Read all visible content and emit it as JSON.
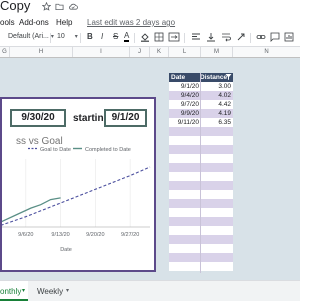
{
  "window": {
    "doc_title": "Copy"
  },
  "menu": {
    "items": [
      "ools",
      "Add-ons",
      "Help"
    ],
    "last_edit": "Last edit was 2 days ago"
  },
  "toolbar": {
    "font_name": "Default (Ari...",
    "font_size": "10",
    "bold": "B",
    "italic": "I",
    "strike": "S",
    "text_color": "A"
  },
  "columns": [
    "G",
    "H",
    "I",
    "J",
    "K",
    "L",
    "M",
    "N"
  ],
  "dashboard": {
    "end_date": "9/30/20",
    "starting_on_label": "starting on",
    "start_date": "9/1/20"
  },
  "table": {
    "headers": [
      "Date",
      "Distance"
    ],
    "rows": [
      {
        "date": "9/1/20",
        "distance": "3.00"
      },
      {
        "date": "9/4/20",
        "distance": "4.02"
      },
      {
        "date": "9/7/20",
        "distance": "4.42"
      },
      {
        "date": "9/9/20",
        "distance": "4.19"
      },
      {
        "date": "9/11/20",
        "distance": "6.35"
      }
    ],
    "row_colors": [
      "#ffffff",
      "#d9d2e9"
    ]
  },
  "chart_data": {
    "type": "line",
    "title": "ss vs Goal",
    "xlabel": "Date",
    "ylabel": "",
    "x_ticks": [
      "9/6/20",
      "9/13/20",
      "9/20/20",
      "9/27/20"
    ],
    "series": [
      {
        "name": "Goal to Date",
        "style": "dashed",
        "color": "#4b4f9e",
        "x": [
          "8/31/20",
          "9/6/20",
          "9/13/20",
          "9/20/20",
          "9/27/20",
          "10/1/20"
        ],
        "y": [
          0,
          6,
          14,
          22,
          30,
          35
        ]
      },
      {
        "name": "Completed to Date",
        "style": "solid",
        "color": "#5a8f86",
        "x": [
          "8/31/20",
          "9/1/20",
          "9/4/20",
          "9/7/20",
          "9/9/20",
          "9/11/20",
          "9/13/20"
        ],
        "y": [
          0,
          3,
          7,
          11,
          13,
          16,
          17
        ]
      }
    ]
  },
  "sheets": {
    "active": "onthly",
    "inactive": "Weekly"
  }
}
